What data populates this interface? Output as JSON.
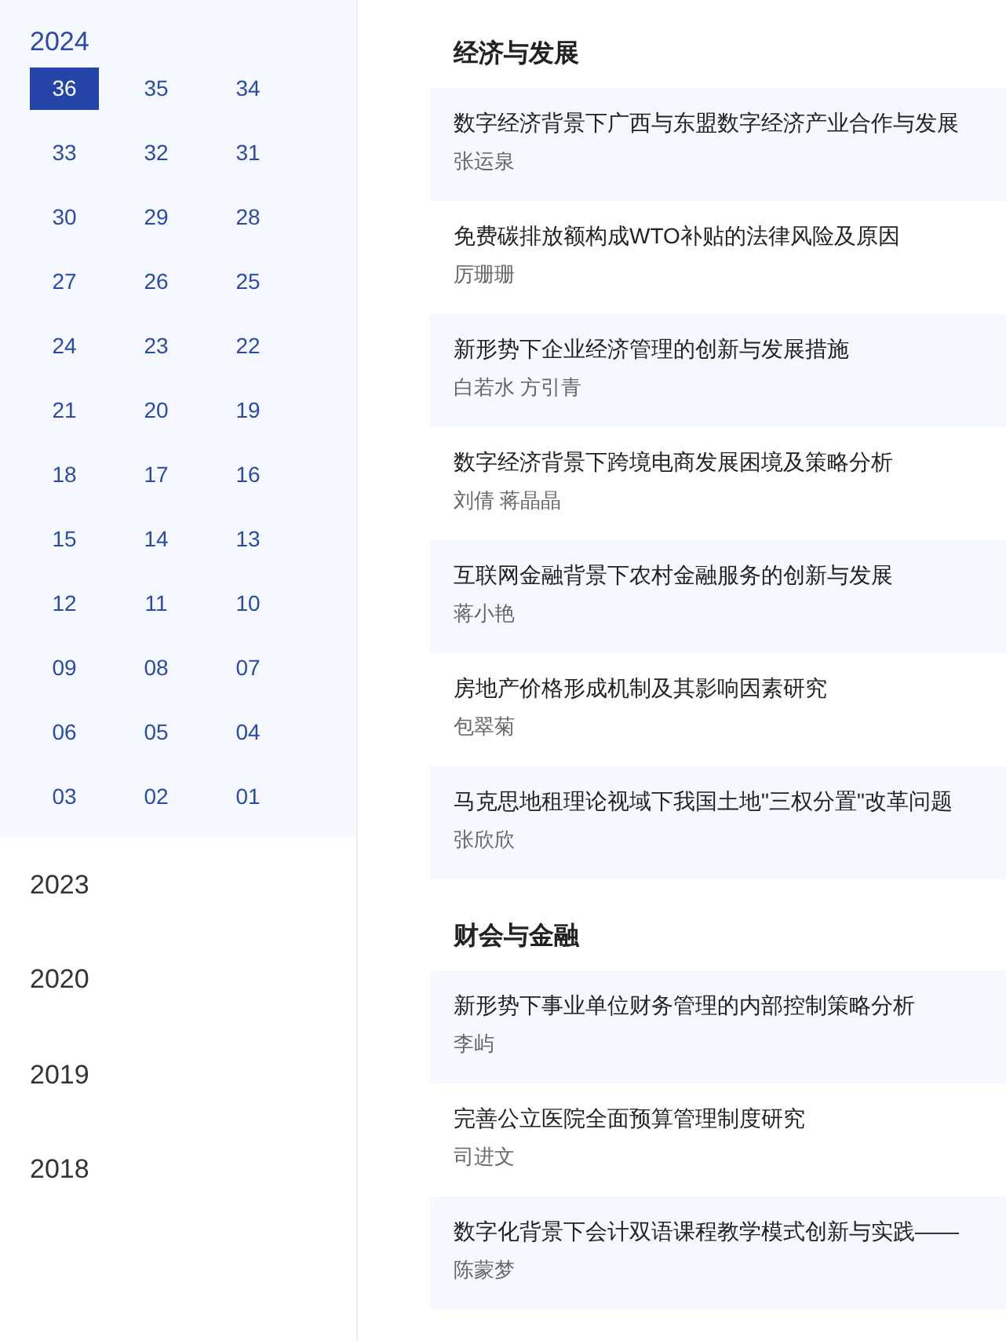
{
  "sidebar": {
    "years": [
      {
        "label": "2024",
        "expanded": true,
        "issues": [
          {
            "label": "36",
            "selected": true
          },
          {
            "label": "35",
            "selected": false
          },
          {
            "label": "34",
            "selected": false
          },
          {
            "label": "33",
            "selected": false
          },
          {
            "label": "32",
            "selected": false
          },
          {
            "label": "31",
            "selected": false
          },
          {
            "label": "30",
            "selected": false
          },
          {
            "label": "29",
            "selected": false
          },
          {
            "label": "28",
            "selected": false
          },
          {
            "label": "27",
            "selected": false
          },
          {
            "label": "26",
            "selected": false
          },
          {
            "label": "25",
            "selected": false
          },
          {
            "label": "24",
            "selected": false
          },
          {
            "label": "23",
            "selected": false
          },
          {
            "label": "22",
            "selected": false
          },
          {
            "label": "21",
            "selected": false
          },
          {
            "label": "20",
            "selected": false
          },
          {
            "label": "19",
            "selected": false
          },
          {
            "label": "18",
            "selected": false
          },
          {
            "label": "17",
            "selected": false
          },
          {
            "label": "16",
            "selected": false
          },
          {
            "label": "15",
            "selected": false
          },
          {
            "label": "14",
            "selected": false
          },
          {
            "label": "13",
            "selected": false
          },
          {
            "label": "12",
            "selected": false
          },
          {
            "label": "11",
            "selected": false
          },
          {
            "label": "10",
            "selected": false
          },
          {
            "label": "09",
            "selected": false
          },
          {
            "label": "08",
            "selected": false
          },
          {
            "label": "07",
            "selected": false
          },
          {
            "label": "06",
            "selected": false
          },
          {
            "label": "05",
            "selected": false
          },
          {
            "label": "04",
            "selected": false
          },
          {
            "label": "03",
            "selected": false
          },
          {
            "label": "02",
            "selected": false
          },
          {
            "label": "01",
            "selected": false
          }
        ]
      },
      {
        "label": "2023",
        "expanded": false
      },
      {
        "label": "2020",
        "expanded": false
      },
      {
        "label": "2019",
        "expanded": false
      },
      {
        "label": "2018",
        "expanded": false
      }
    ]
  },
  "sections": [
    {
      "title": "经济与发展",
      "articles": [
        {
          "title": "数字经济背景下广西与东盟数字经济产业合作与发展",
          "authors": "张运泉"
        },
        {
          "title": "免费碳排放额构成WTO补贴的法律风险及原因",
          "authors": "厉珊珊"
        },
        {
          "title": "新形势下企业经济管理的创新与发展措施",
          "authors": "白若水 方引青"
        },
        {
          "title": "数字经济背景下跨境电商发展困境及策略分析",
          "authors": "刘倩 蒋晶晶"
        },
        {
          "title": "互联网金融背景下农村金融服务的创新与发展",
          "authors": "蒋小艳"
        },
        {
          "title": "房地产价格形成机制及其影响因素研究",
          "authors": "包翠菊"
        },
        {
          "title": "马克思地租理论视域下我国土地\"三权分置\"改革问题",
          "authors": "张欣欣"
        }
      ]
    },
    {
      "title": "财会与金融",
      "articles": [
        {
          "title": "新形势下事业单位财务管理的内部控制策略分析",
          "authors": "李屿"
        },
        {
          "title": "完善公立医院全面预算管理制度研究",
          "authors": "司进文"
        },
        {
          "title": "数字化背景下会计双语课程教学模式创新与实践——",
          "authors": "陈蒙梦"
        }
      ]
    }
  ]
}
